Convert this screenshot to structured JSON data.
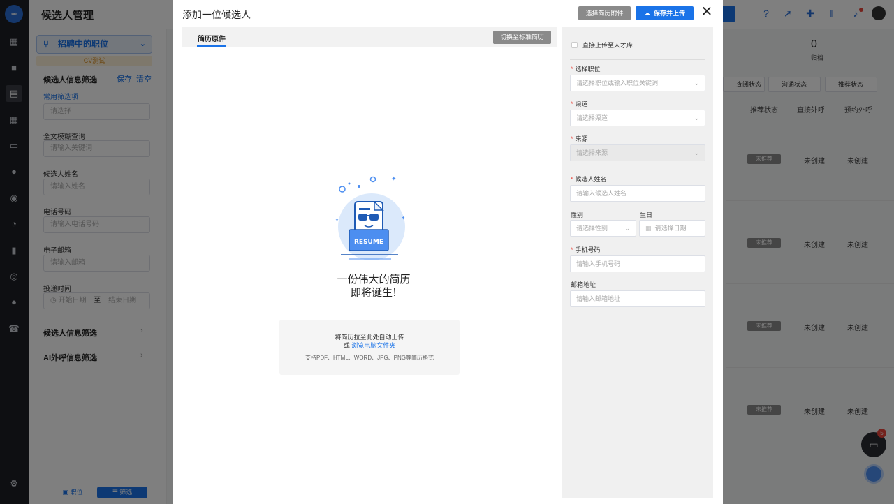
{
  "page": {
    "title": "候选人管理",
    "filters": {
      "job_selector": "招聘中的职位",
      "cv_tag": "CV测试",
      "panel_title": "候选人信息筛选",
      "save": "保存",
      "clear": "清空",
      "common_filters": "常用筛选项",
      "common_placeholder": "请选择",
      "fulltext_label": "全文模糊查询",
      "fulltext_placeholder": "请输入关键词",
      "name_label": "候选人姓名",
      "name_placeholder": "请输入姓名",
      "phone_label": "电话号码",
      "phone_placeholder": "请输入电话号码",
      "email_label": "电子邮箱",
      "email_placeholder": "请输入邮箱",
      "delivery_label": "投递时间",
      "date_start": "开始日期",
      "date_to": "至",
      "date_end": "结束日期",
      "section_info": "候选人信息筛选",
      "section_ai": "AI外呼信息筛选",
      "tab_position": "职位",
      "tab_filter": "筛选"
    },
    "stats": {
      "archived_count": "0",
      "archived_label": "归档"
    },
    "dropdowns": [
      "查阅状态",
      "沟通状态",
      "推荐状态"
    ],
    "columns": [
      "推荐状态",
      "直接外呼",
      "预约外呼"
    ],
    "rows": [
      {
        "tag": "未推荐",
        "call": "未创建",
        "schedule": "未创建"
      },
      {
        "tag": "未推荐",
        "call": "未创建",
        "schedule": "未创建"
      },
      {
        "tag": "未推荐",
        "call": "未创建",
        "schedule": "未创建"
      },
      {
        "tag": "未推荐",
        "call": "未创建",
        "schedule": "未创建"
      }
    ],
    "chat_badge": "5"
  },
  "modal": {
    "title": "添加一位候选人",
    "select_attachment": "选择简历附件",
    "save_upload": "保存并上传",
    "close": "✕",
    "tab_original": "简历原件",
    "switch_standard": "切换至标准简历",
    "slogan_line1": "一份伟大的简历",
    "slogan_line2": "即将诞生!",
    "upload_line1": "将简历拉至此处自动上传",
    "upload_or": "或",
    "upload_browse": "浏览电脑文件夹",
    "upload_formats": "支持PDF、HTML、WORD、JPG、PNG等简历格式",
    "resume_word": "RESUME"
  },
  "form": {
    "direct_upload": "直接上传至人才库",
    "job_label": "选择职位",
    "job_placeholder": "请选择职位或输入职位关键词",
    "channel_label": "渠道",
    "channel_placeholder": "请选择渠道",
    "source_label": "来源",
    "source_placeholder": "请选择来源",
    "name_label": "候选人姓名",
    "name_placeholder": "请输入候选人姓名",
    "gender_label": "性别",
    "gender_placeholder": "请选择性别",
    "birthday_label": "生日",
    "birthday_placeholder": "请选择日期",
    "phone_label": "手机号码",
    "phone_placeholder": "请输入手机号码",
    "email_label": "邮箱地址",
    "email_placeholder": "请输入邮箱地址"
  },
  "colors": {
    "primary": "#1a73e8",
    "rail": "#1d1f24",
    "required": "#e8443a",
    "gray_button": "#8a8a8a"
  }
}
